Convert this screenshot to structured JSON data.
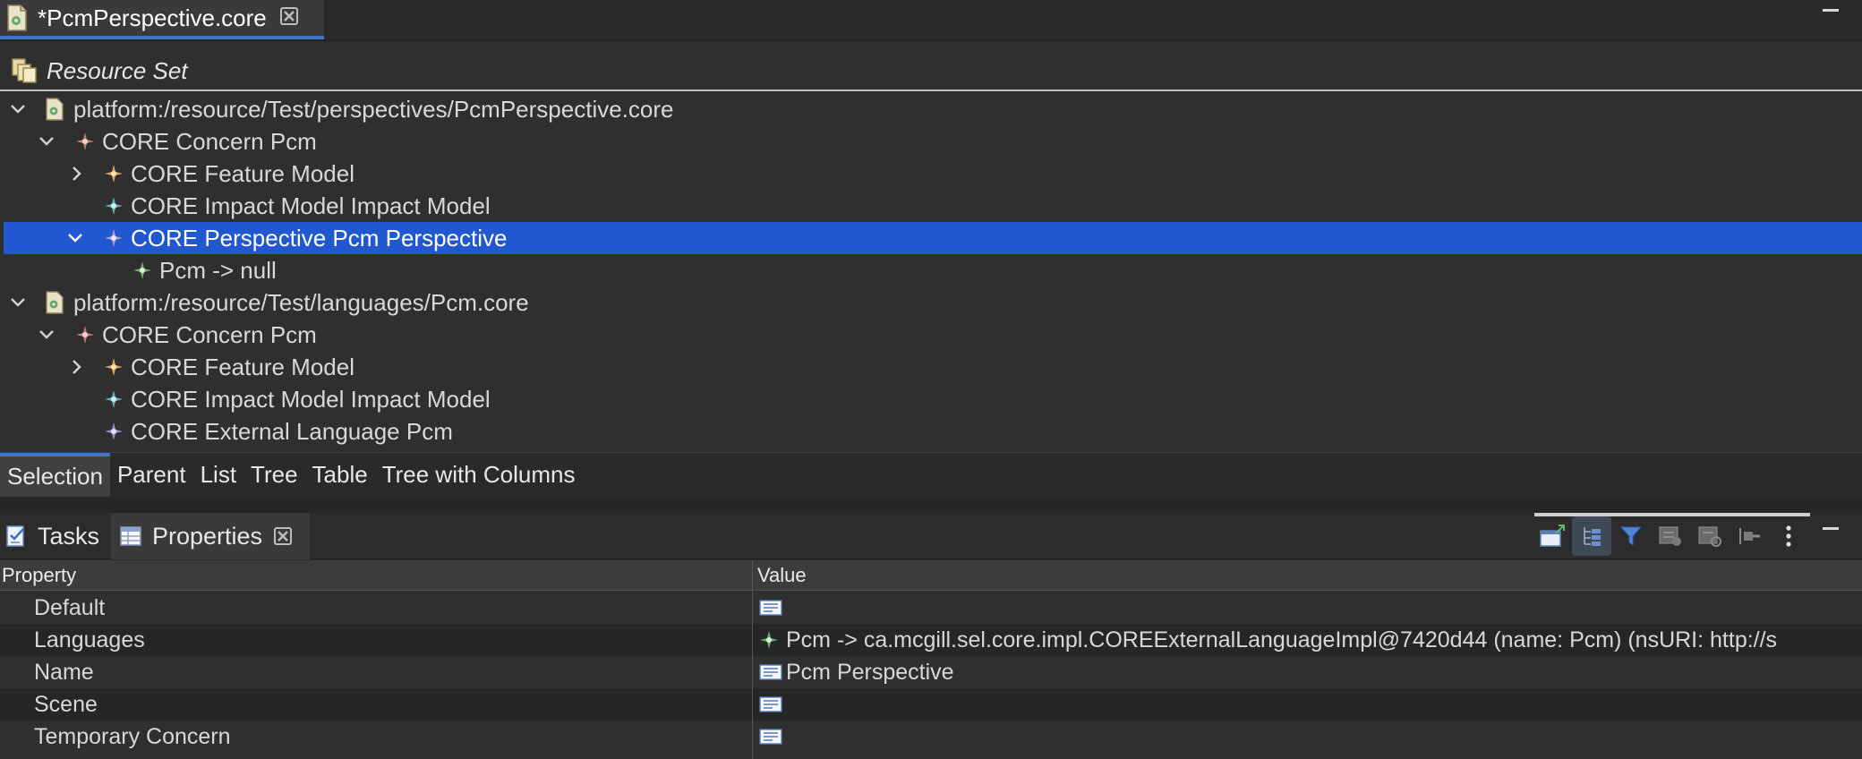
{
  "editor": {
    "tab_title": "*PcmPerspective.core",
    "file_icon": "core-file-icon",
    "close_icon": "close-icon"
  },
  "resource_set": {
    "label": "Resource Set",
    "icon": "resource-set-icon"
  },
  "tree": {
    "rows": [
      {
        "label": "platform:/resource/Test/perspectives/PcmPerspective.core",
        "expander": "expanded",
        "icon": "core-file-icon"
      },
      {
        "label": "CORE Concern Pcm",
        "expander": "expanded",
        "icon": "concern-icon"
      },
      {
        "label": "CORE Feature Model",
        "expander": "collapsed",
        "icon": "feature-model-icon"
      },
      {
        "label": "CORE Impact Model Impact Model",
        "expander": "none",
        "icon": "impact-model-icon"
      },
      {
        "label": "CORE Perspective Pcm Perspective",
        "expander": "expanded",
        "icon": "perspective-icon",
        "selected": true
      },
      {
        "label": "Pcm -> null",
        "expander": "none",
        "icon": "language-mapping-icon"
      },
      {
        "label": "platform:/resource/Test/languages/Pcm.core",
        "expander": "expanded",
        "icon": "core-file-icon"
      },
      {
        "label": "CORE Concern Pcm",
        "expander": "expanded",
        "icon": "concern-icon"
      },
      {
        "label": "CORE Feature Model",
        "expander": "collapsed",
        "icon": "feature-model-icon"
      },
      {
        "label": "CORE Impact Model Impact Model",
        "expander": "none",
        "icon": "impact-model-icon"
      },
      {
        "label": "CORE External Language Pcm",
        "expander": "none",
        "icon": "external-language-icon"
      }
    ]
  },
  "editor_tabs": {
    "items": [
      "Selection",
      "Parent",
      "List",
      "Tree",
      "Table",
      "Tree with Columns"
    ],
    "active": "Selection"
  },
  "views": {
    "tasks_label": "Tasks",
    "properties_label": "Properties",
    "active": "Properties",
    "toolbar_icons": [
      "new-window-icon",
      "categories-icon",
      "filter-icon",
      "advanced-icon",
      "restore-default-icon",
      "pin-icon",
      "view-menu-icon"
    ]
  },
  "properties": {
    "columns": {
      "property": "Property",
      "value": "Value"
    },
    "rows": [
      {
        "name": "Default",
        "value": ""
      },
      {
        "name": "Languages",
        "value": "Pcm -> ca.mcgill.sel.core.impl.COREExternalLanguageImpl@7420d44 (name: Pcm) (nsURI: http://s"
      },
      {
        "name": "Name",
        "value": "Pcm Perspective"
      },
      {
        "name": "Scene",
        "value": ""
      },
      {
        "name": "Temporary Concern",
        "value": ""
      }
    ]
  },
  "colors": {
    "selection": "#2158cf",
    "accent": "#3f74c6",
    "background": "#2f2f2f"
  }
}
